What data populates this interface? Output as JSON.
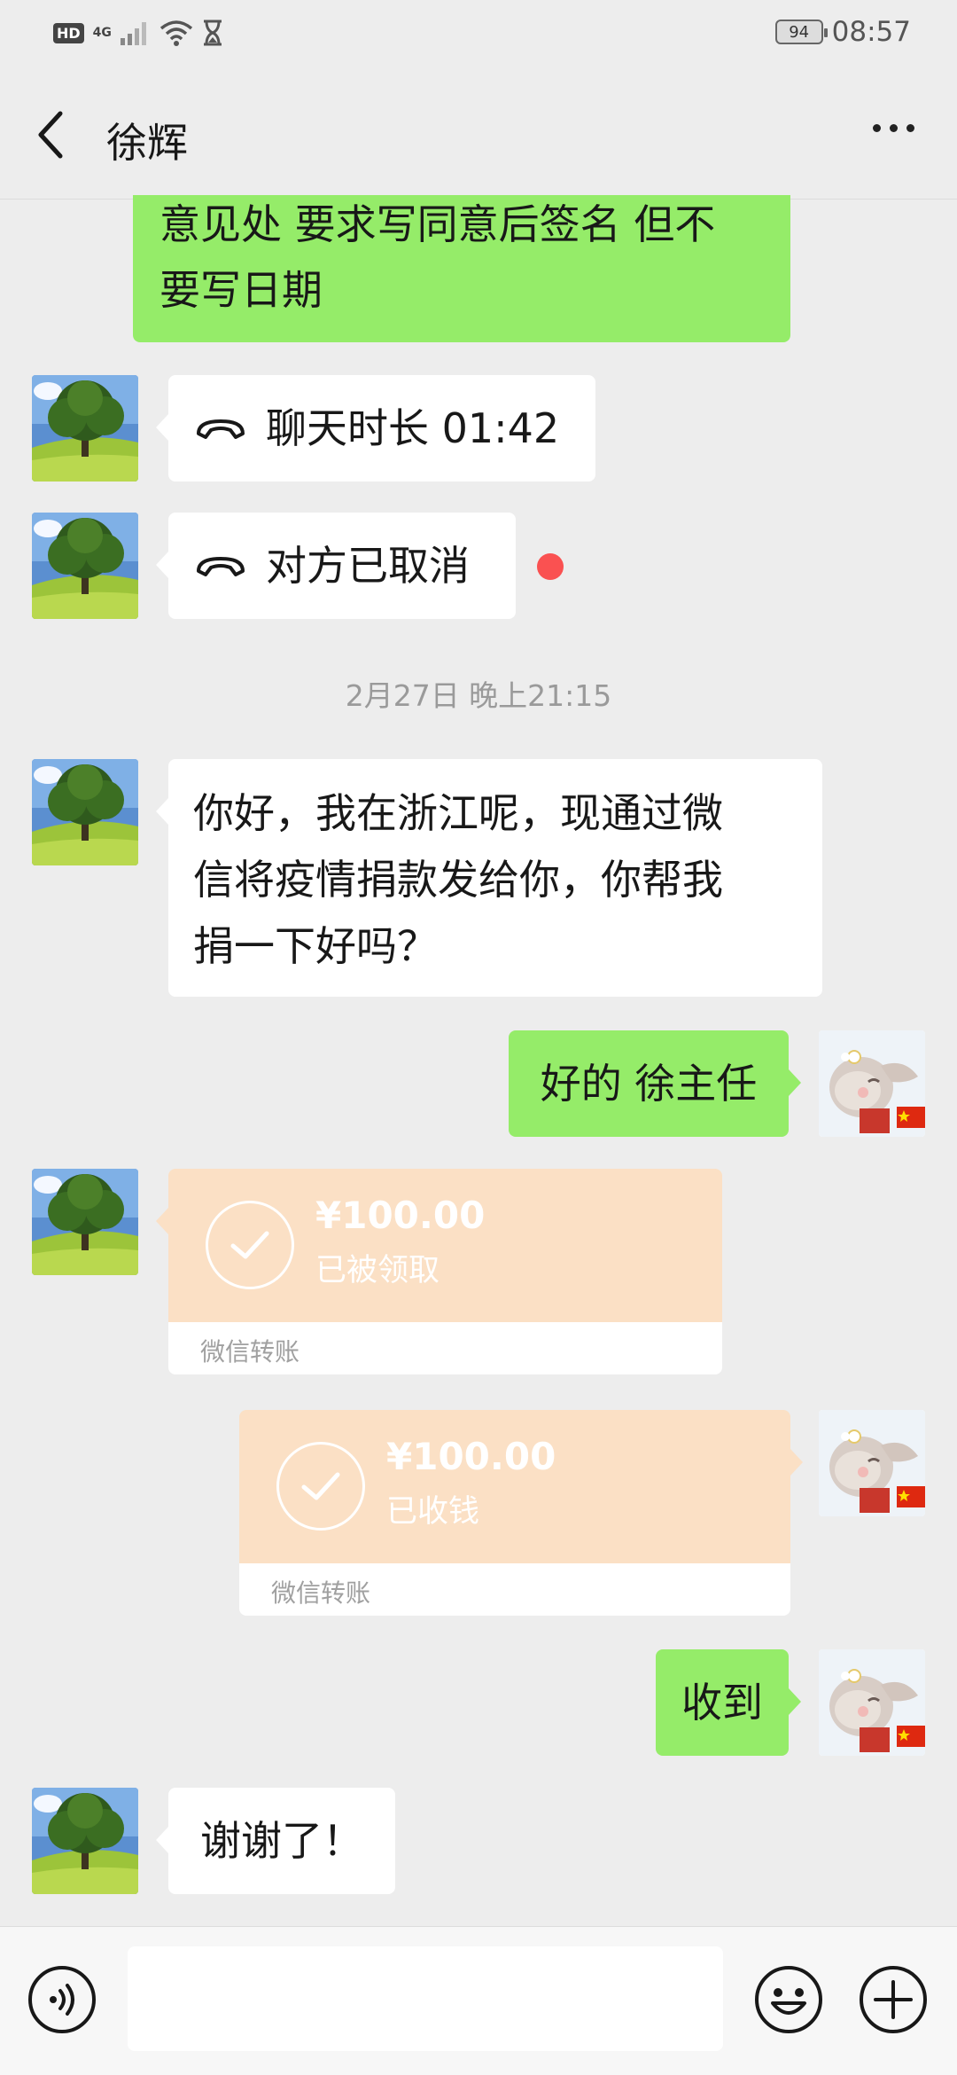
{
  "status_bar": {
    "hd": "HD",
    "network": "4G",
    "battery": "94",
    "time": "08:57"
  },
  "header": {
    "contact_name": "徐辉",
    "back_icon": "chevron-left-icon",
    "more_icon": "more-dots-icon"
  },
  "messages": {
    "m1": {
      "side": "sent",
      "lines": [
        "意见处 要求写同意后签名 但不",
        "要写日期"
      ]
    },
    "m2": {
      "side": "received",
      "type": "call",
      "text": "聊天时长 01:42"
    },
    "m3": {
      "side": "received",
      "type": "call",
      "text": "对方已取消",
      "unread_dot": true
    },
    "timestamp": "2月27日 晚上21:15",
    "m4": {
      "side": "received",
      "lines": [
        "你好，我在浙江呢，现通过微",
        "信将疫情捐款发给你，你帮我",
        "捐一下好吗？"
      ]
    },
    "m5": {
      "side": "sent",
      "text": "好的 徐主任"
    },
    "m6": {
      "side": "received",
      "type": "transfer",
      "amount": "¥100.00",
      "status": "已被领取",
      "label": "微信转账"
    },
    "m7": {
      "side": "sent",
      "type": "transfer",
      "amount": "¥100.00",
      "status": "已收钱",
      "label": "微信转账"
    },
    "m8": {
      "side": "sent",
      "text": "收到"
    },
    "m9": {
      "side": "received",
      "text": "谢谢了！"
    }
  },
  "input_bar": {
    "voice_icon": "voice-icon",
    "input_value": "",
    "emoji_icon": "emoji-icon",
    "plus_icon": "plus-icon"
  },
  "colors": {
    "background": "#ededed",
    "sent_bubble": "#95ec69",
    "received_bubble": "#ffffff",
    "transfer": "#fbe0c5",
    "unread_dot": "#fa5151"
  }
}
